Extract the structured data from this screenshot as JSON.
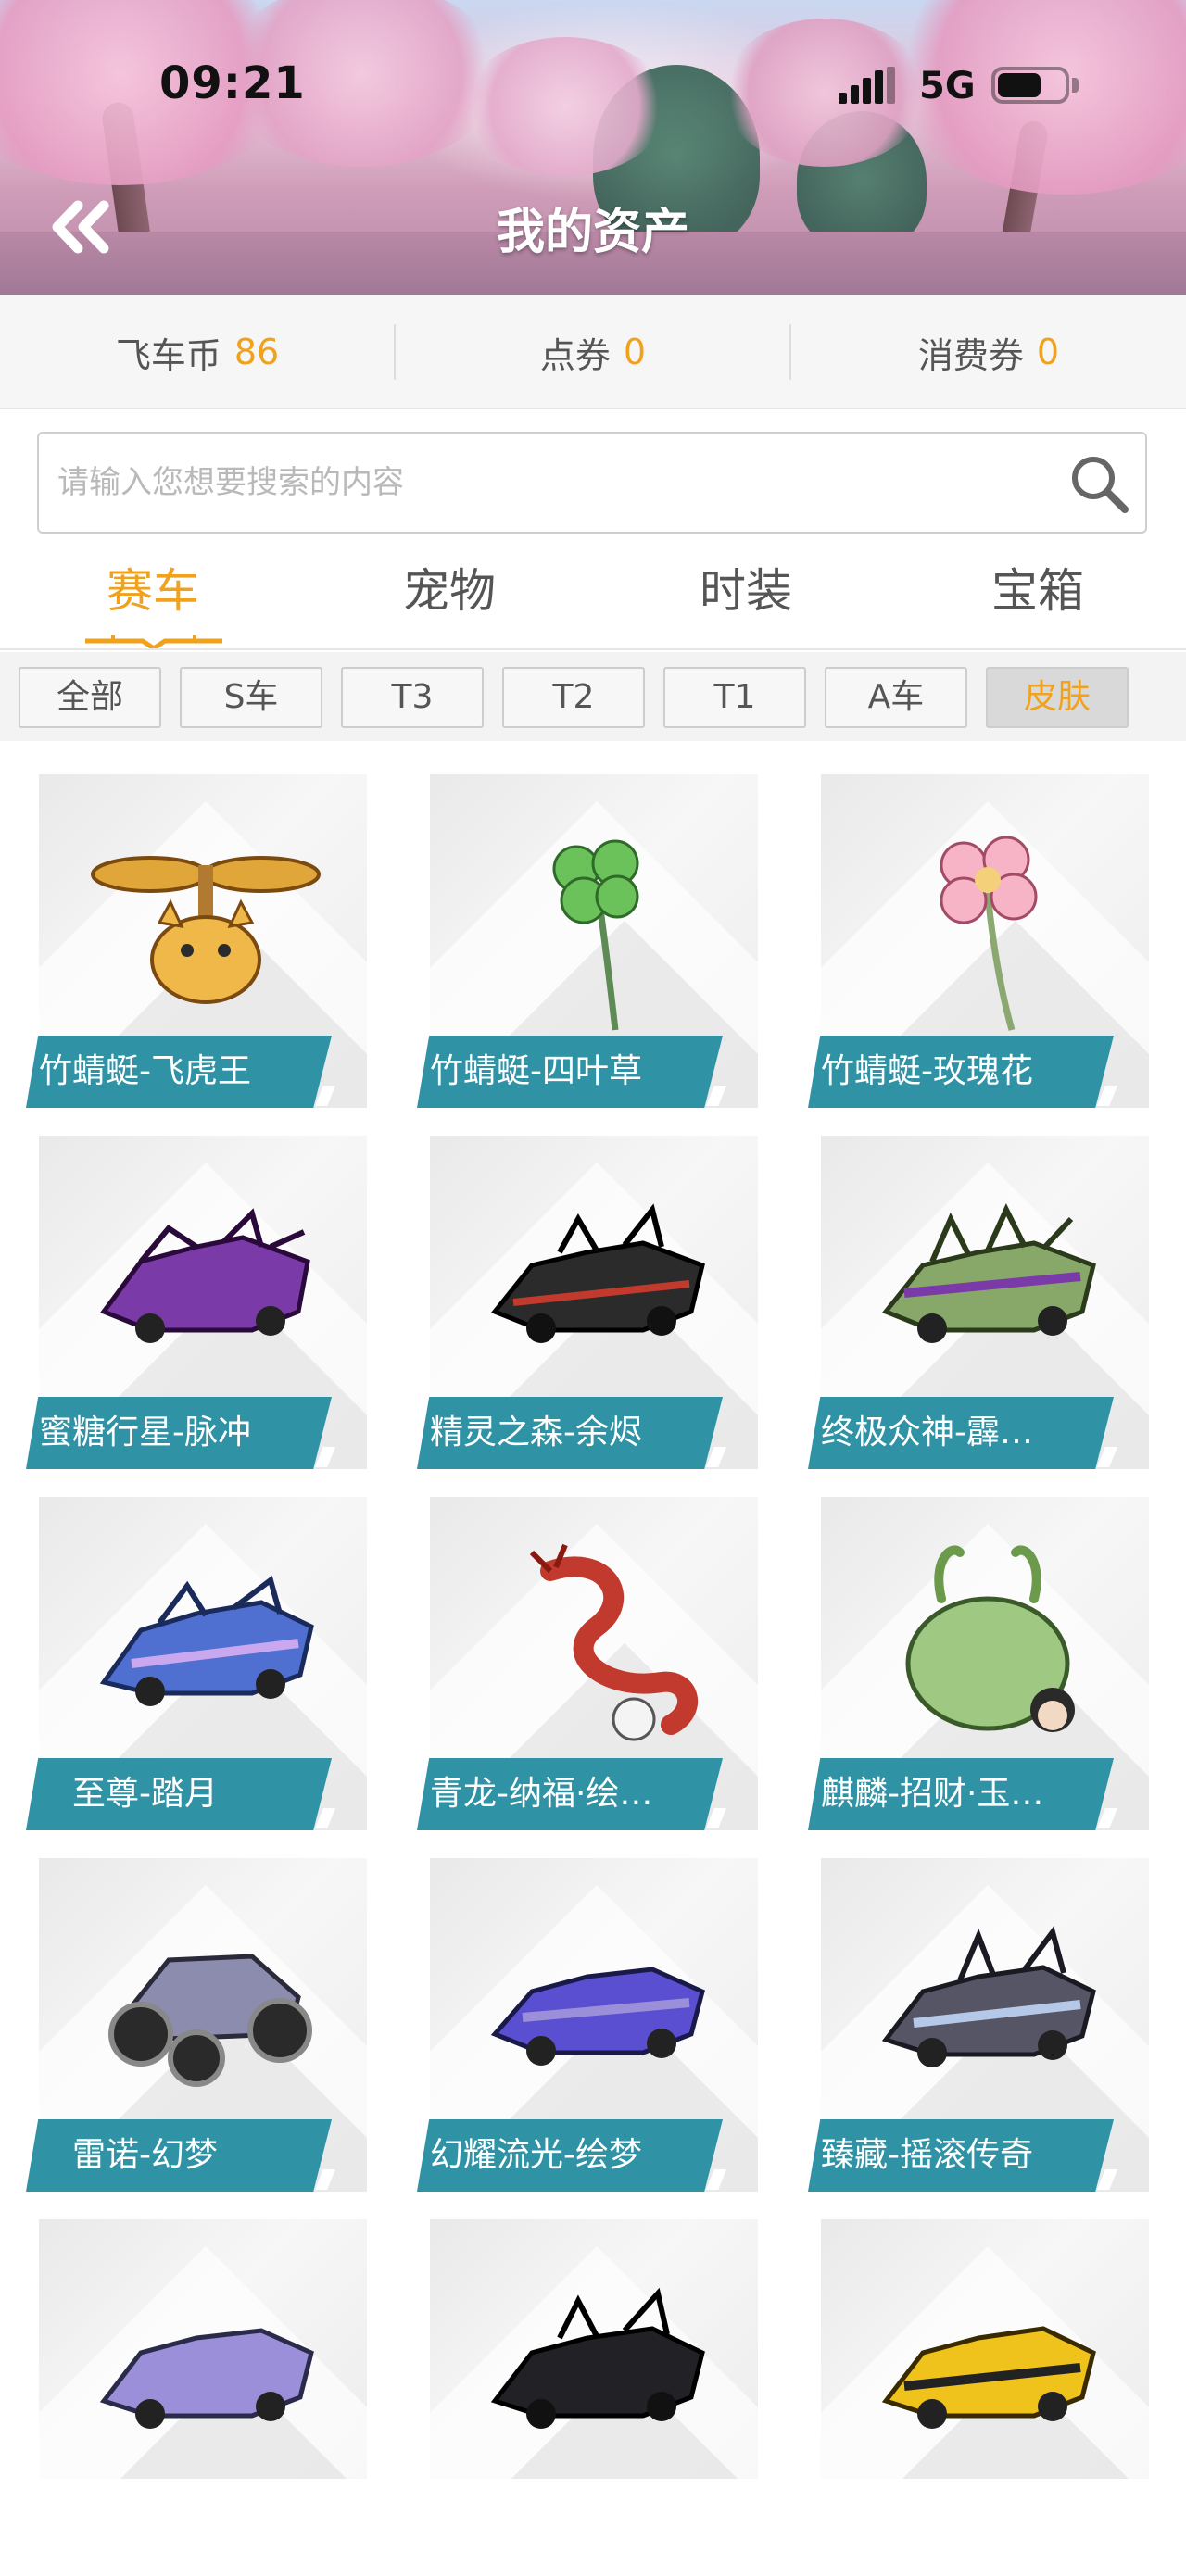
{
  "status": {
    "time": "09:21",
    "network": "5G"
  },
  "header": {
    "title": "我的资产"
  },
  "currencies": [
    {
      "label": "飞车币",
      "value": "86"
    },
    {
      "label": "点券",
      "value": "0"
    },
    {
      "label": "消费券",
      "value": "0"
    }
  ],
  "search": {
    "placeholder": "请输入您想要搜索的内容"
  },
  "main_tabs": [
    {
      "label": "赛车",
      "active": true
    },
    {
      "label": "宠物",
      "active": false
    },
    {
      "label": "时装",
      "active": false
    },
    {
      "label": "宝箱",
      "active": false
    }
  ],
  "sub_tabs": [
    {
      "label": "全部",
      "active": false
    },
    {
      "label": "S车",
      "active": false
    },
    {
      "label": "T3",
      "active": false
    },
    {
      "label": "T2",
      "active": false
    },
    {
      "label": "T1",
      "active": false
    },
    {
      "label": "A车",
      "active": false
    },
    {
      "label": "皮肤",
      "active": true
    }
  ],
  "items": [
    {
      "name": "竹蜻蜓-飞虎王",
      "art": "cat-propeller-icon"
    },
    {
      "name": "竹蜻蜓-四叶草",
      "art": "clover-icon"
    },
    {
      "name": "竹蜻蜓-玫瑰花",
      "art": "flower-icon"
    },
    {
      "name": "蜜糖行星-脉冲",
      "art": "kart-icon"
    },
    {
      "name": "精灵之森-余烬",
      "art": "kart-icon"
    },
    {
      "name": "终极众神-霹…",
      "art": "kart-icon"
    },
    {
      "name": "至尊-踏月",
      "art": "kart-icon"
    },
    {
      "name": "青龙-纳福·绘…",
      "art": "dragon-icon"
    },
    {
      "name": "麒麟-招财·玉…",
      "art": "qilin-icon"
    },
    {
      "name": "雷诺-幻梦",
      "art": "buggy-icon"
    },
    {
      "name": "幻耀流光-绘梦",
      "art": "kart-icon"
    },
    {
      "name": "臻藏-摇滚传奇",
      "art": "kart-icon"
    },
    {
      "name": "",
      "art": "kart-icon"
    },
    {
      "name": "",
      "art": "kart-icon"
    },
    {
      "name": "",
      "art": "kart-icon"
    }
  ],
  "colors": {
    "accent": "#f0a21c",
    "label_bg": "#2f93a5",
    "kart_palette": [
      "#7a3aa8",
      "#2b2b2b",
      "#7fbf6a",
      "#4f6fd1",
      "#c23a2e",
      "#88a86a",
      "#555566",
      "#5a4fd0",
      "#8c8cae",
      "#9a8fd8",
      "#222226",
      "#f0c21c"
    ]
  }
}
